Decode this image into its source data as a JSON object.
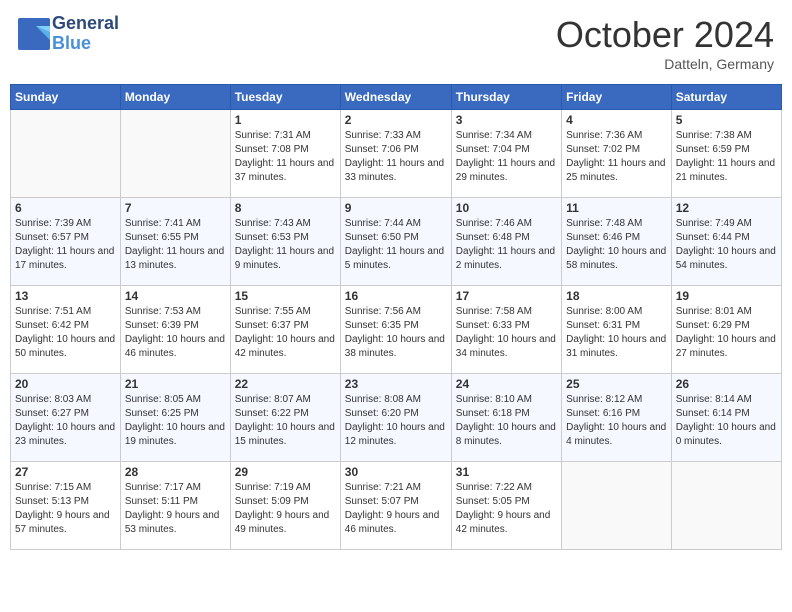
{
  "header": {
    "logo_general": "General",
    "logo_blue": "Blue",
    "month_title": "October 2024",
    "location": "Datteln, Germany"
  },
  "days_of_week": [
    "Sunday",
    "Monday",
    "Tuesday",
    "Wednesday",
    "Thursday",
    "Friday",
    "Saturday"
  ],
  "weeks": [
    [
      {
        "day": "",
        "sunrise": "",
        "sunset": "",
        "daylight": ""
      },
      {
        "day": "",
        "sunrise": "",
        "sunset": "",
        "daylight": ""
      },
      {
        "day": "1",
        "sunrise": "Sunrise: 7:31 AM",
        "sunset": "Sunset: 7:08 PM",
        "daylight": "Daylight: 11 hours and 37 minutes."
      },
      {
        "day": "2",
        "sunrise": "Sunrise: 7:33 AM",
        "sunset": "Sunset: 7:06 PM",
        "daylight": "Daylight: 11 hours and 33 minutes."
      },
      {
        "day": "3",
        "sunrise": "Sunrise: 7:34 AM",
        "sunset": "Sunset: 7:04 PM",
        "daylight": "Daylight: 11 hours and 29 minutes."
      },
      {
        "day": "4",
        "sunrise": "Sunrise: 7:36 AM",
        "sunset": "Sunset: 7:02 PM",
        "daylight": "Daylight: 11 hours and 25 minutes."
      },
      {
        "day": "5",
        "sunrise": "Sunrise: 7:38 AM",
        "sunset": "Sunset: 6:59 PM",
        "daylight": "Daylight: 11 hours and 21 minutes."
      }
    ],
    [
      {
        "day": "6",
        "sunrise": "Sunrise: 7:39 AM",
        "sunset": "Sunset: 6:57 PM",
        "daylight": "Daylight: 11 hours and 17 minutes."
      },
      {
        "day": "7",
        "sunrise": "Sunrise: 7:41 AM",
        "sunset": "Sunset: 6:55 PM",
        "daylight": "Daylight: 11 hours and 13 minutes."
      },
      {
        "day": "8",
        "sunrise": "Sunrise: 7:43 AM",
        "sunset": "Sunset: 6:53 PM",
        "daylight": "Daylight: 11 hours and 9 minutes."
      },
      {
        "day": "9",
        "sunrise": "Sunrise: 7:44 AM",
        "sunset": "Sunset: 6:50 PM",
        "daylight": "Daylight: 11 hours and 5 minutes."
      },
      {
        "day": "10",
        "sunrise": "Sunrise: 7:46 AM",
        "sunset": "Sunset: 6:48 PM",
        "daylight": "Daylight: 11 hours and 2 minutes."
      },
      {
        "day": "11",
        "sunrise": "Sunrise: 7:48 AM",
        "sunset": "Sunset: 6:46 PM",
        "daylight": "Daylight: 10 hours and 58 minutes."
      },
      {
        "day": "12",
        "sunrise": "Sunrise: 7:49 AM",
        "sunset": "Sunset: 6:44 PM",
        "daylight": "Daylight: 10 hours and 54 minutes."
      }
    ],
    [
      {
        "day": "13",
        "sunrise": "Sunrise: 7:51 AM",
        "sunset": "Sunset: 6:42 PM",
        "daylight": "Daylight: 10 hours and 50 minutes."
      },
      {
        "day": "14",
        "sunrise": "Sunrise: 7:53 AM",
        "sunset": "Sunset: 6:39 PM",
        "daylight": "Daylight: 10 hours and 46 minutes."
      },
      {
        "day": "15",
        "sunrise": "Sunrise: 7:55 AM",
        "sunset": "Sunset: 6:37 PM",
        "daylight": "Daylight: 10 hours and 42 minutes."
      },
      {
        "day": "16",
        "sunrise": "Sunrise: 7:56 AM",
        "sunset": "Sunset: 6:35 PM",
        "daylight": "Daylight: 10 hours and 38 minutes."
      },
      {
        "day": "17",
        "sunrise": "Sunrise: 7:58 AM",
        "sunset": "Sunset: 6:33 PM",
        "daylight": "Daylight: 10 hours and 34 minutes."
      },
      {
        "day": "18",
        "sunrise": "Sunrise: 8:00 AM",
        "sunset": "Sunset: 6:31 PM",
        "daylight": "Daylight: 10 hours and 31 minutes."
      },
      {
        "day": "19",
        "sunrise": "Sunrise: 8:01 AM",
        "sunset": "Sunset: 6:29 PM",
        "daylight": "Daylight: 10 hours and 27 minutes."
      }
    ],
    [
      {
        "day": "20",
        "sunrise": "Sunrise: 8:03 AM",
        "sunset": "Sunset: 6:27 PM",
        "daylight": "Daylight: 10 hours and 23 minutes."
      },
      {
        "day": "21",
        "sunrise": "Sunrise: 8:05 AM",
        "sunset": "Sunset: 6:25 PM",
        "daylight": "Daylight: 10 hours and 19 minutes."
      },
      {
        "day": "22",
        "sunrise": "Sunrise: 8:07 AM",
        "sunset": "Sunset: 6:22 PM",
        "daylight": "Daylight: 10 hours and 15 minutes."
      },
      {
        "day": "23",
        "sunrise": "Sunrise: 8:08 AM",
        "sunset": "Sunset: 6:20 PM",
        "daylight": "Daylight: 10 hours and 12 minutes."
      },
      {
        "day": "24",
        "sunrise": "Sunrise: 8:10 AM",
        "sunset": "Sunset: 6:18 PM",
        "daylight": "Daylight: 10 hours and 8 minutes."
      },
      {
        "day": "25",
        "sunrise": "Sunrise: 8:12 AM",
        "sunset": "Sunset: 6:16 PM",
        "daylight": "Daylight: 10 hours and 4 minutes."
      },
      {
        "day": "26",
        "sunrise": "Sunrise: 8:14 AM",
        "sunset": "Sunset: 6:14 PM",
        "daylight": "Daylight: 10 hours and 0 minutes."
      }
    ],
    [
      {
        "day": "27",
        "sunrise": "Sunrise: 7:15 AM",
        "sunset": "Sunset: 5:13 PM",
        "daylight": "Daylight: 9 hours and 57 minutes."
      },
      {
        "day": "28",
        "sunrise": "Sunrise: 7:17 AM",
        "sunset": "Sunset: 5:11 PM",
        "daylight": "Daylight: 9 hours and 53 minutes."
      },
      {
        "day": "29",
        "sunrise": "Sunrise: 7:19 AM",
        "sunset": "Sunset: 5:09 PM",
        "daylight": "Daylight: 9 hours and 49 minutes."
      },
      {
        "day": "30",
        "sunrise": "Sunrise: 7:21 AM",
        "sunset": "Sunset: 5:07 PM",
        "daylight": "Daylight: 9 hours and 46 minutes."
      },
      {
        "day": "31",
        "sunrise": "Sunrise: 7:22 AM",
        "sunset": "Sunset: 5:05 PM",
        "daylight": "Daylight: 9 hours and 42 minutes."
      },
      {
        "day": "",
        "sunrise": "",
        "sunset": "",
        "daylight": ""
      },
      {
        "day": "",
        "sunrise": "",
        "sunset": "",
        "daylight": ""
      }
    ]
  ]
}
